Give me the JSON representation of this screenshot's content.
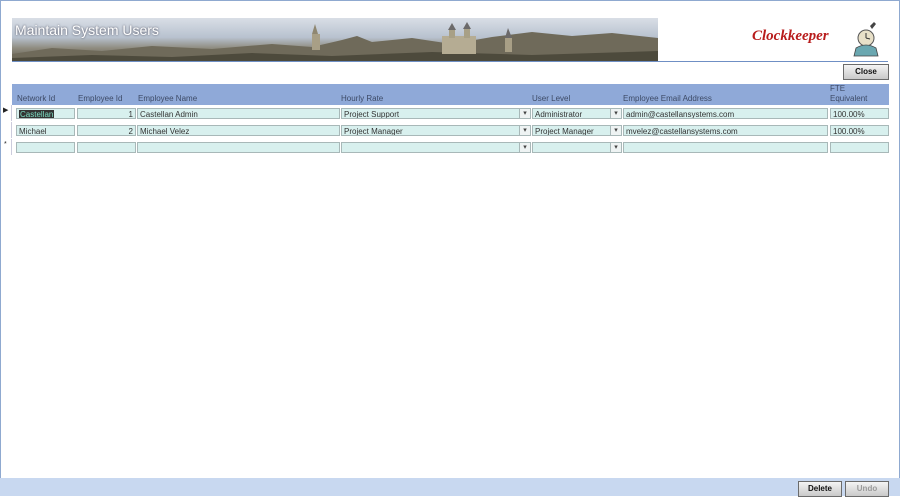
{
  "form": {
    "title": "Maintain System Users",
    "logo_text": "Clockkeeper",
    "close_label": "Close",
    "delete_label": "Delete",
    "undo_label": "Undo"
  },
  "columns": {
    "network_id": "Network Id",
    "employee_id": "Employee Id",
    "employee_name": "Employee Name",
    "hourly_rate": "Hourly Rate",
    "user_level": "User Level",
    "email": "Employee Email Address",
    "fte_line1": "FTE",
    "fte_line2": "Equivalent"
  },
  "rows": [
    {
      "network_id": "Castellan",
      "employee_id": "1",
      "employee_name": "Castellan Admin",
      "hourly_rate": "Project Support",
      "user_level": "Administrator",
      "email": "admin@castellansystems.com",
      "fte": "100.00%"
    },
    {
      "network_id": "Michael",
      "employee_id": "2",
      "employee_name": "Michael Velez",
      "hourly_rate": "Project Manager",
      "user_level": "Project Manager",
      "email": "mvelez@castellansystems.com",
      "fte": "100.00%"
    }
  ],
  "selector": {
    "current_glyph": "▶",
    "new_glyph": "*"
  },
  "icons": {
    "combo": "▾"
  },
  "colors": {
    "header_bg": "#8fa9d8",
    "field_bg": "#d8f0ee",
    "logo_red": "#b81c1c",
    "footer_bg": "#c8d8f0"
  }
}
